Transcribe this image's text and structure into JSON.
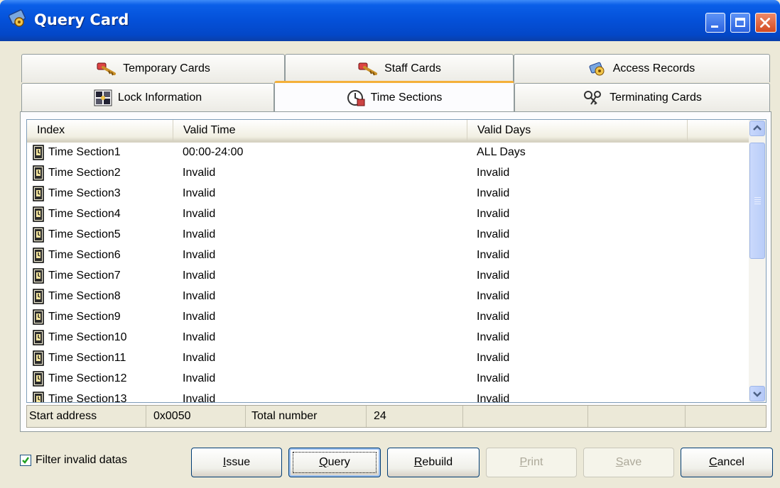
{
  "window": {
    "title": "Query Card",
    "title_icon": "key-card-icon"
  },
  "tabs": {
    "row1": [
      {
        "label": "Temporary Cards",
        "icon": "key-icon"
      },
      {
        "label": "Staff Cards",
        "icon": "key-icon"
      },
      {
        "label": "Access Records",
        "icon": "key-card-icon"
      }
    ],
    "row2": [
      {
        "label": "Lock Information",
        "icon": "lock-info-icon"
      },
      {
        "label": "Time Sections",
        "icon": "clock-icon",
        "active": true
      },
      {
        "label": "Terminating Cards",
        "icon": "terminate-key-icon"
      }
    ]
  },
  "list": {
    "columns": [
      "Index",
      "Valid Time",
      "Valid Days"
    ],
    "rows": [
      {
        "index": "Time Section1",
        "valid_time": "00:00-24:00",
        "valid_days": "ALL Days"
      },
      {
        "index": "Time Section2",
        "valid_time": "Invalid",
        "valid_days": "Invalid"
      },
      {
        "index": "Time Section3",
        "valid_time": "Invalid",
        "valid_days": "Invalid"
      },
      {
        "index": "Time Section4",
        "valid_time": "Invalid",
        "valid_days": "Invalid"
      },
      {
        "index": "Time Section5",
        "valid_time": "Invalid",
        "valid_days": "Invalid"
      },
      {
        "index": "Time Section6",
        "valid_time": "Invalid",
        "valid_days": "Invalid"
      },
      {
        "index": "Time Section7",
        "valid_time": "Invalid",
        "valid_days": "Invalid"
      },
      {
        "index": "Time Section8",
        "valid_time": "Invalid",
        "valid_days": "Invalid"
      },
      {
        "index": "Time Section9",
        "valid_time": "Invalid",
        "valid_days": "Invalid"
      },
      {
        "index": "Time Section10",
        "valid_time": "Invalid",
        "valid_days": "Invalid"
      },
      {
        "index": "Time Section11",
        "valid_time": "Invalid",
        "valid_days": "Invalid"
      },
      {
        "index": "Time Section12",
        "valid_time": "Invalid",
        "valid_days": "Invalid"
      },
      {
        "index": "Time Section13",
        "valid_time": "Invalid",
        "valid_days": "Invalid"
      }
    ]
  },
  "status": {
    "start_address_label": "Start address",
    "start_address_value": "0x0050",
    "total_number_label": "Total number",
    "total_number_value": "24"
  },
  "controls": {
    "filter_label": "Filter invalid datas",
    "filter_checked": true,
    "buttons": [
      {
        "label": "Issue",
        "accel": "I",
        "rest": "ssue",
        "enabled": true
      },
      {
        "label": "Query",
        "accel": "Q",
        "rest": "uery",
        "enabled": true,
        "focused": true
      },
      {
        "label": "Rebuild",
        "accel": "R",
        "rest": "ebuild",
        "enabled": true
      },
      {
        "label": "Print",
        "accel": "P",
        "rest": "rint",
        "enabled": false
      },
      {
        "label": "Save",
        "accel": "S",
        "rest": "ave",
        "enabled": false
      },
      {
        "label": "Cancel",
        "accel": "C",
        "rest": "ancel",
        "enabled": true
      }
    ]
  },
  "colors": {
    "titlebar": "#0450d8",
    "active_tab_accent": "#f4b03a",
    "window_bg": "#ece9d8"
  }
}
